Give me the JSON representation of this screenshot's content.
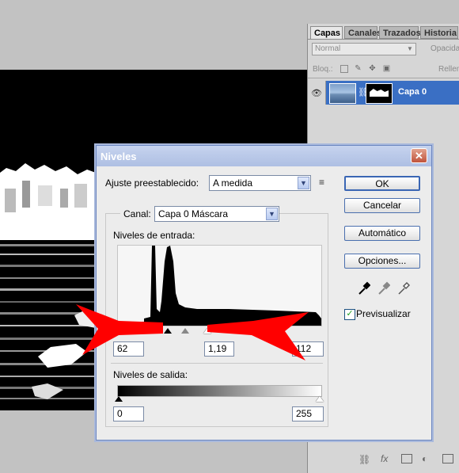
{
  "layers_panel": {
    "tabs": [
      {
        "label": "Capas",
        "active": true
      },
      {
        "label": "Canales",
        "active": false
      },
      {
        "label": "Trazados",
        "active": false
      },
      {
        "label": "Historia",
        "active": false
      }
    ],
    "blend_mode": "Normal",
    "opacity_label": "Opacidad",
    "lock_label": "Bloq.:",
    "fill_label": "Relleno",
    "layer_name": "Capa 0"
  },
  "dialog": {
    "title": "Niveles",
    "preset_label": "Ajuste preestablecido:",
    "preset_value": "A medida",
    "channel_label": "Canal:",
    "channel_value": "Capa 0 Máscara",
    "input_levels_label": "Niveles de entrada:",
    "input_black": "62",
    "input_gamma": "1,19",
    "input_white": "112",
    "output_levels_label": "Niveles de salida:",
    "output_black": "0",
    "output_white": "255",
    "buttons": {
      "ok": "OK",
      "cancel": "Cancelar",
      "auto": "Automático",
      "options": "Opciones..."
    },
    "preview_label": "Previsualizar",
    "preview_checked": true
  },
  "colors": {
    "annotation_arrows": "#ff0000",
    "selected_layer": "#3a6fc4"
  }
}
